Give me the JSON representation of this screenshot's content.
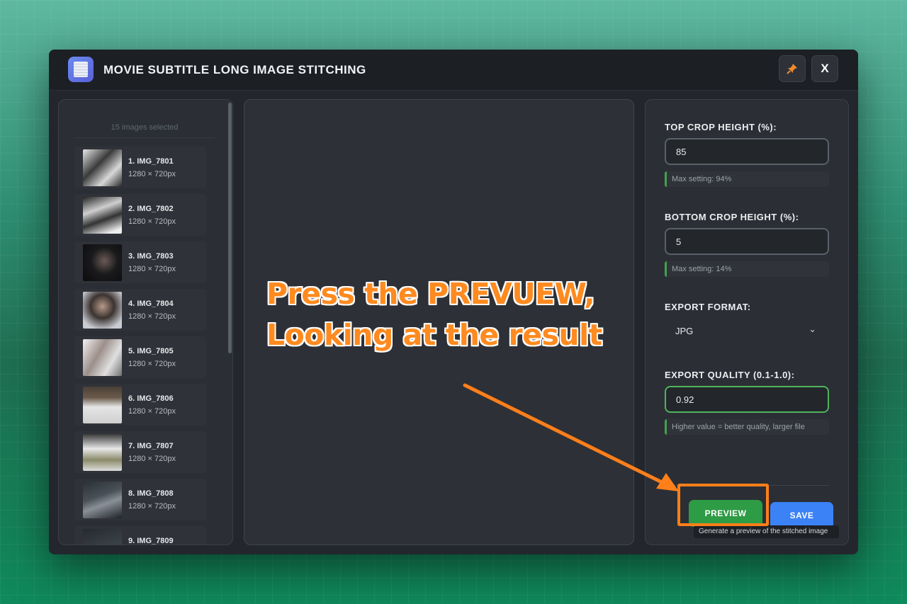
{
  "window": {
    "title": "MOVIE SUBTITLE LONG IMAGE STITCHING",
    "close_label": "X"
  },
  "sidebar": {
    "selection_count": "15 images selected",
    "images": [
      {
        "name": "1. IMG_7801",
        "size": "1280 × 720px"
      },
      {
        "name": "2. IMG_7802",
        "size": "1280 × 720px"
      },
      {
        "name": "3. IMG_7803",
        "size": "1280 × 720px"
      },
      {
        "name": "4. IMG_7804",
        "size": "1280 × 720px"
      },
      {
        "name": "5. IMG_7805",
        "size": "1280 × 720px"
      },
      {
        "name": "6. IMG_7806",
        "size": "1280 × 720px"
      },
      {
        "name": "7. IMG_7807",
        "size": "1280 × 720px"
      },
      {
        "name": "8. IMG_7808",
        "size": "1280 × 720px"
      },
      {
        "name": "9. IMG_7809",
        "size": ""
      }
    ]
  },
  "settings": {
    "top_crop": {
      "label": "TOP CROP HEIGHT (%):",
      "value": "85",
      "hint": "Max setting: 94%"
    },
    "bottom_crop": {
      "label": "BOTTOM CROP HEIGHT (%):",
      "value": "5",
      "hint": "Max setting: 14%"
    },
    "export_format": {
      "label": "EXPORT FORMAT:",
      "value": "JPG"
    },
    "export_quality": {
      "label": "EXPORT QUALITY (0.1-1.0):",
      "value": "0.92",
      "hint": "Higher value = better quality, larger file"
    },
    "preview_label": "PREVIEW",
    "save_label": "SAVE",
    "preview_tooltip": "Generate a preview of the stitched image"
  },
  "annotation": {
    "line1": "Press the PREVUEW,",
    "line2": "Looking at the result",
    "color": "#ff8a1f"
  },
  "colors": {
    "preview_button": "#2e9b45",
    "save_button": "#3b82f6",
    "active_field_border": "#4fb35c"
  }
}
